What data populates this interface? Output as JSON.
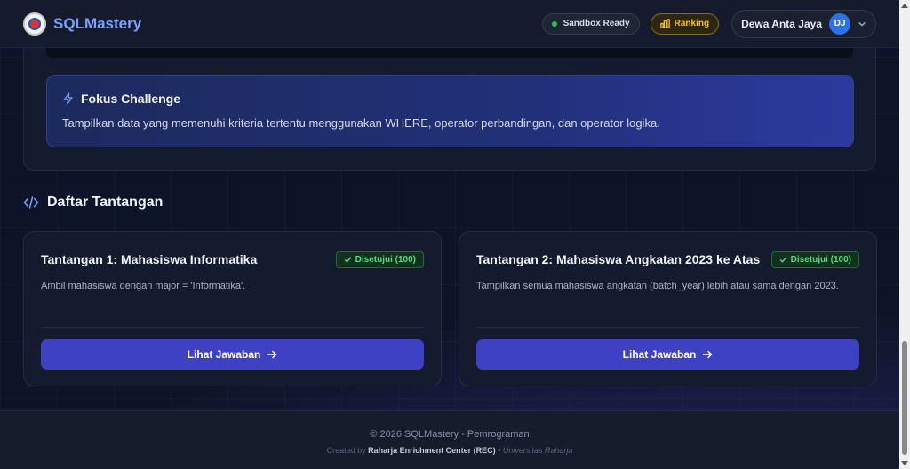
{
  "header": {
    "brand": "SQLMastery",
    "sandbox_status": "Sandbox Ready",
    "ranking_label": "Ranking",
    "user_name": "Dewa Anta Jaya",
    "user_initials": "DJ"
  },
  "focus": {
    "title": "Fokus Challenge",
    "description": "Tampilkan data yang memenuhi kriteria tertentu menggunakan WHERE, operator perbandingan, dan operator logika."
  },
  "section": {
    "title": "Daftar Tantangan"
  },
  "challenges": [
    {
      "title": "Tantangan 1: Mahasiswa Informatika",
      "status": "Disetujui (100)",
      "description": "Ambil mahasiswa dengan major = 'Informatika'.",
      "button": "Lihat Jawaban"
    },
    {
      "title": "Tantangan 2: Mahasiswa Angkatan 2023 ke Atas",
      "status": "Disetujui (100)",
      "description": "Tampilkan semua mahasiswa angkatan (batch_year) lebih atau sama dengan 2023.",
      "button": "Lihat Jawaban"
    }
  ],
  "footer": {
    "copyright": "© 2026 SQLMastery - Pemrograman",
    "created_by": "Created by",
    "org": "Raharja Enrichment Center (REC)",
    "separator": "•",
    "university": "Universitas Raharja"
  },
  "colors": {
    "accent": "#3f41c4",
    "brand": "#7aa2ff",
    "success": "#4ade80",
    "ranking": "#f5c518"
  },
  "icons": [
    "logo",
    "status-dot-icon",
    "chart-bar-icon",
    "chevron-down-icon",
    "lightning-icon",
    "code-icon",
    "check-icon",
    "arrow-right-icon"
  ]
}
